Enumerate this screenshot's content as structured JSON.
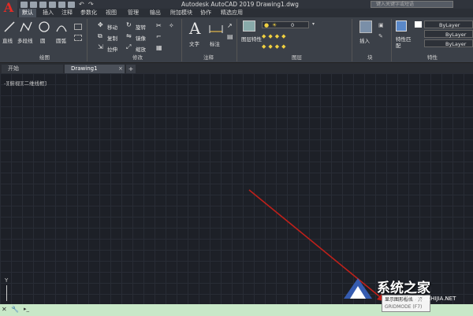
{
  "window": {
    "title": "Autodesk AutoCAD 2019    Drawing1.dwg",
    "search_placeholder": "键入关键字或短语"
  },
  "ribbon_tabs": [
    "默认",
    "插入",
    "注释",
    "参数化",
    "视图",
    "管理",
    "输出",
    "附加模块",
    "协作",
    "精选应用"
  ],
  "draw_panel": {
    "buttons": [
      "直线",
      "多段线",
      "圆",
      "圆弧"
    ],
    "title": "绘图"
  },
  "modify_panel": {
    "buttons": [
      "移动",
      "旋转",
      "复制",
      "镜像",
      "拉伸",
      "缩放"
    ],
    "title": "修改"
  },
  "annotation_panel": {
    "buttons": [
      "文字",
      "标注"
    ],
    "title": "注释"
  },
  "layer_panel": {
    "buttons": [
      "图层特性"
    ],
    "layer_value": "0",
    "title": "图层"
  },
  "block_panel": {
    "buttons": [
      "插入"
    ],
    "title": "块"
  },
  "properties_panel": {
    "buttons": [
      "特性匹配"
    ],
    "values": [
      "ByLayer",
      "ByLayer",
      "ByLayer"
    ],
    "title": "特性"
  },
  "doc_tabs": [
    "开始",
    "Drawing1"
  ],
  "viewport_label": "-][俯视][二维线框]",
  "axis_label": "Y",
  "tooltip": {
    "line1": "显示图形栅格 - 开",
    "line2": "GRIDMODE (F7)"
  },
  "watermark": {
    "name": "系统之家",
    "url": "XITONGZHIJIA.NET"
  },
  "colors": {
    "accent_red": "#e32b25",
    "arrow": "#c0201a",
    "cmdbar": "#c8e8c8"
  }
}
